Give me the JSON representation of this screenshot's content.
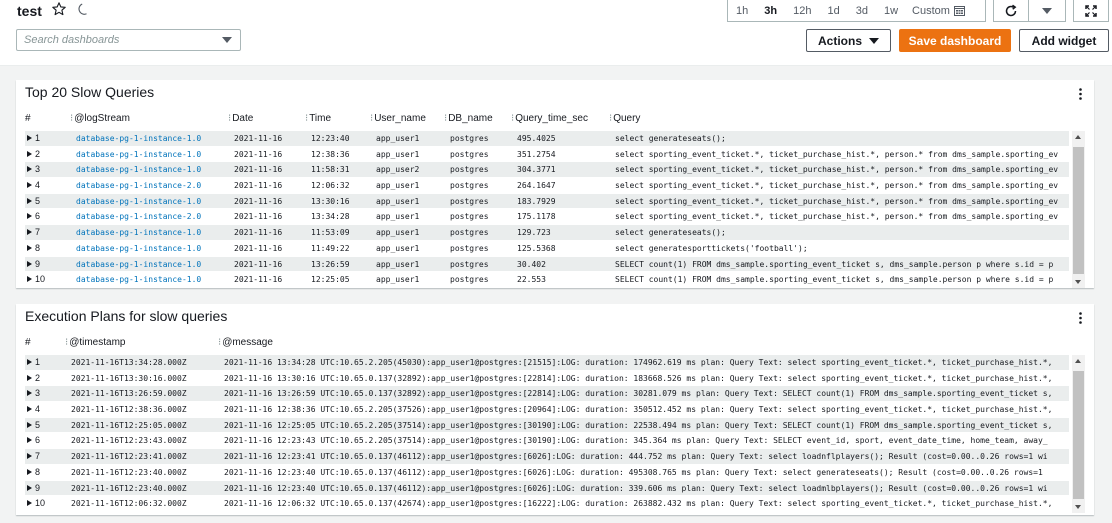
{
  "header": {
    "title": "test",
    "search_placeholder": "Search dashboards",
    "time_ranges": [
      "1h",
      "3h",
      "12h",
      "1d",
      "3d",
      "1w"
    ],
    "active_range": "3h",
    "custom_label": "Custom",
    "actions_label": "Actions",
    "save_label": "Save dashboard",
    "add_widget_label": "Add widget",
    "accent_color": "#ec7211"
  },
  "widget1": {
    "title": "Top 20 Slow Queries",
    "columns": [
      "#",
      "@logStream",
      "Date",
      "Time",
      "User_name",
      "DB_name",
      "Query_time_sec",
      "Query"
    ],
    "rows": [
      [
        "1",
        "database-pg-1-instance-1.0",
        "2021-11-16",
        "12:23:40",
        "app_user1",
        "postgres",
        "495.4025",
        "select generateseats();"
      ],
      [
        "2",
        "database-pg-1-instance-1.0",
        "2021-11-16",
        "12:38:36",
        "app_user1",
        "postgres",
        "351.2754",
        "select sporting_event_ticket.*, ticket_purchase_hist.*, person.* from dms_sample.sporting_ev"
      ],
      [
        "3",
        "database-pg-1-instance-1.0",
        "2021-11-16",
        "11:58:31",
        "app_user2",
        "postgres",
        "304.3771",
        "select sporting_event_ticket.*, ticket_purchase_hist.*, person.* from dms_sample.sporting_ev"
      ],
      [
        "4",
        "database-pg-1-instance-2.0",
        "2021-11-16",
        "12:06:32",
        "app_user1",
        "postgres",
        "264.1647",
        "select sporting_event_ticket.*, ticket_purchase_hist.*, person.* from dms_sample.sporting_ev"
      ],
      [
        "5",
        "database-pg-1-instance-1.0",
        "2021-11-16",
        "13:30:16",
        "app_user1",
        "postgres",
        "183.7929",
        "select sporting_event_ticket.*, ticket_purchase_hist.*, person.* from dms_sample.sporting_ev"
      ],
      [
        "6",
        "database-pg-1-instance-2.0",
        "2021-11-16",
        "13:34:28",
        "app_user1",
        "postgres",
        "175.1178",
        "select sporting_event_ticket.*, ticket_purchase_hist.*, person.* from dms_sample.sporting_ev"
      ],
      [
        "7",
        "database-pg-1-instance-1.0",
        "2021-11-16",
        "11:53:09",
        "app_user1",
        "postgres",
        "129.723",
        "select generateseats();"
      ],
      [
        "8",
        "database-pg-1-instance-1.0",
        "2021-11-16",
        "11:49:22",
        "app_user1",
        "postgres",
        "125.5368",
        "select generatesporttickets('football');"
      ],
      [
        "9",
        "database-pg-1-instance-1.0",
        "2021-11-16",
        "13:26:59",
        "app_user1",
        "postgres",
        "30.402",
        "SELECT count(1) FROM dms_sample.sporting_event_ticket s, dms_sample.person p where s.id = p"
      ],
      [
        "10",
        "database-pg-1-instance-1.0",
        "2021-11-16",
        "12:25:05",
        "app_user1",
        "postgres",
        "22.553",
        "SELECT count(1) FROM dms_sample.sporting_event_ticket s, dms_sample.person p where s.id = p"
      ]
    ]
  },
  "widget2": {
    "title": "Execution Plans for slow queries",
    "columns": [
      "#",
      "@timestamp",
      "@message"
    ],
    "rows": [
      [
        "1",
        "2021-11-16T13:34:28.000Z",
        "2021-11-16 13:34:28 UTC:10.65.2.205(45030):app_user1@postgres:[21515]:LOG: duration: 174962.619 ms plan: Query Text: select sporting_event_ticket.*, ticket_purchase_hist.*,"
      ],
      [
        "2",
        "2021-11-16T13:30:16.000Z",
        "2021-11-16 13:30:16 UTC:10.65.0.137(32892):app_user1@postgres:[22814]:LOG: duration: 183668.526 ms plan: Query Text: select sporting_event_ticket.*, ticket_purchase_hist.*,"
      ],
      [
        "3",
        "2021-11-16T13:26:59.000Z",
        "2021-11-16 13:26:59 UTC:10.65.0.137(32892):app_user1@postgres:[22814]:LOG: duration: 30281.079 ms plan: Query Text: SELECT count(1) FROM dms_sample.sporting_event_ticket s,"
      ],
      [
        "4",
        "2021-11-16T12:38:36.000Z",
        "2021-11-16 12:38:36 UTC:10.65.2.205(37526):app_user1@postgres:[20964]:LOG: duration: 350512.452 ms plan: Query Text: select sporting_event_ticket.*, ticket_purchase_hist.*,"
      ],
      [
        "5",
        "2021-11-16T12:25:05.000Z",
        "2021-11-16 12:25:05 UTC:10.65.2.205(37514):app_user1@postgres:[30190]:LOG: duration: 22538.494 ms plan: Query Text: SELECT count(1) FROM dms_sample.sporting_event_ticket s,"
      ],
      [
        "6",
        "2021-11-16T12:23:43.000Z",
        "2021-11-16 12:23:43 UTC:10.65.2.205(37514):app_user1@postgres:[30190]:LOG: duration: 345.364 ms plan: Query Text: SELECT event_id, sport, event_date_time, home_team, away_"
      ],
      [
        "7",
        "2021-11-16T12:23:41.000Z",
        "2021-11-16 12:23:41 UTC:10.65.0.137(46112):app_user1@postgres:[6026]:LOG: duration: 444.752 ms plan: Query Text: select loadnflplayers(); Result (cost=0.00..0.26 rows=1 wi"
      ],
      [
        "8",
        "2021-11-16T12:23:40.000Z",
        "2021-11-16 12:23:40 UTC:10.65.0.137(46112):app_user1@postgres:[6026]:LOG: duration: 495308.765 ms plan: Query Text: select generateseats(); Result (cost=0.00..0.26 rows=1"
      ],
      [
        "9",
        "2021-11-16T12:23:40.000Z",
        "2021-11-16 12:23:40 UTC:10.65.0.137(46112):app_user1@postgres:[6026]:LOG: duration: 339.606 ms plan: Query Text: select loadmlbplayers(); Result (cost=0.00..0.26 rows=1 wi"
      ],
      [
        "10",
        "2021-11-16T12:06:32.000Z",
        "2021-11-16 12:06:32 UTC:10.65.0.137(42674):app_user1@postgres:[16222]:LOG: duration: 263882.432 ms plan: Query Text: select sporting_event_ticket.*, ticket_purchase_hist.*,"
      ]
    ]
  }
}
